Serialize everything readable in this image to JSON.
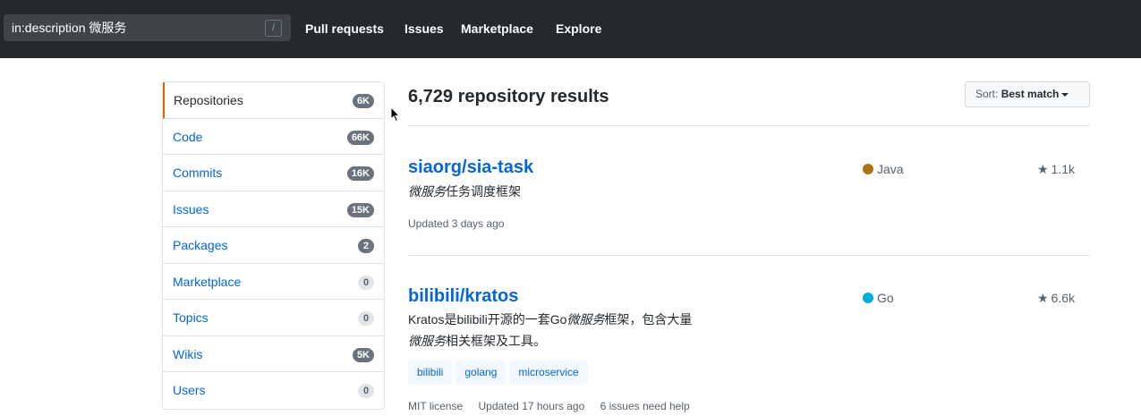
{
  "header": {
    "search_value": "in:description 微服务",
    "slash_key": "/",
    "nav": [
      "Pull requests",
      "Issues",
      "Marketplace",
      "Explore"
    ]
  },
  "sidebar": {
    "items": [
      {
        "label": "Repositories",
        "count": "6K",
        "selected": true
      },
      {
        "label": "Code",
        "count": "66K"
      },
      {
        "label": "Commits",
        "count": "16K"
      },
      {
        "label": "Issues",
        "count": "15K"
      },
      {
        "label": "Packages",
        "count": "2"
      },
      {
        "label": "Marketplace",
        "count": "0"
      },
      {
        "label": "Topics",
        "count": "0"
      },
      {
        "label": "Wikis",
        "count": "5K"
      },
      {
        "label": "Users",
        "count": "0"
      }
    ]
  },
  "results": {
    "title": "6,729 repository results",
    "sort_prefix": "Sort:",
    "sort_value": "Best match"
  },
  "repos": [
    {
      "name": "siaorg/sia-task",
      "desc_em": "微服务",
      "desc_rest": "任务调度框架",
      "language": "Java",
      "language_color": "#b07219",
      "stars": "1.1k",
      "updated": "Updated 3 days ago"
    },
    {
      "name": "bilibili/kratos",
      "desc_part1": "Kratos是bilibili开源的一套Go",
      "desc_em1": "微服务",
      "desc_part2": "框架，包含大量",
      "desc_em2": "微服务",
      "desc_part3": "相关框架及工具。",
      "language": "Go",
      "language_color": "#00add8",
      "stars": "6.6k",
      "topics": [
        "bilibili",
        "golang",
        "microservice"
      ],
      "license": "MIT license",
      "updated": "Updated 17 hours ago",
      "issues_help": "6 issues need help"
    }
  ]
}
